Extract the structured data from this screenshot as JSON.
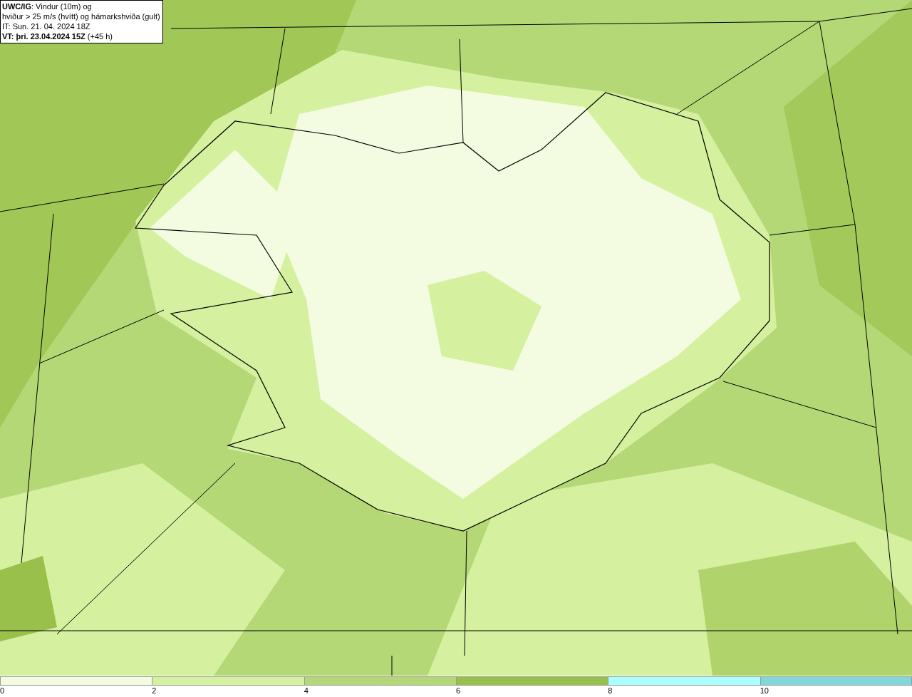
{
  "caption": {
    "lines": [
      "**UWC/IG**: Vindur (10m) og",
      "hviður > 25 m/s (hvítt) og hámarkshviða (gult)",
      "IT: Sun. 21. 04. 2024 18Z",
      "**VT: þri. 23.04.2024 15Z** (+45 h)"
    ]
  },
  "legend": {
    "segments": [
      {
        "label": "0",
        "color": "#f3fbe0"
      },
      {
        "label": "2",
        "color": "#d5f09e"
      },
      {
        "label": "4",
        "color": "#b4d876"
      },
      {
        "label": "6",
        "color": "#98c04a"
      },
      {
        "label": "8",
        "color": "#aaffff"
      },
      {
        "label": "10",
        "color": "#80d8d8"
      }
    ]
  }
}
